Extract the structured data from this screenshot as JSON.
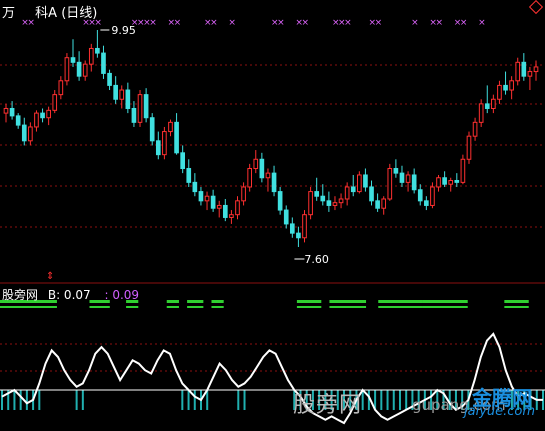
{
  "header": {
    "code_label": "万",
    "stock_label": "科A",
    "period_label": "(日线)"
  },
  "subpanel": {
    "name": "股旁网",
    "b_label": "B: 0.07",
    "value2_label": ": 0.09"
  },
  "watermark": {
    "text_cn": "股旁网",
    "url": "gupang.com",
    "logo_line1": "金腾网",
    "logo_line2": "jaiyue.com"
  },
  "colors": {
    "up": "#ff3030",
    "down": "#40e0e0",
    "grid": "#8b1010",
    "cross": "#e066ff",
    "indicator": "#ffffff",
    "bars": "#20b0b0",
    "signal": "#30d030"
  },
  "chart_data": {
    "type": "candlestick",
    "price_max_label": "9.95",
    "price_min_label": "7.60",
    "price_max": 9.95,
    "price_min": 7.6,
    "candles": [
      [
        9.05,
        9.15,
        8.95,
        9.1
      ],
      [
        9.1,
        9.18,
        8.98,
        9.02
      ],
      [
        9.02,
        9.05,
        8.88,
        8.92
      ],
      [
        8.92,
        9.0,
        8.7,
        8.75
      ],
      [
        8.75,
        8.95,
        8.7,
        8.9
      ],
      [
        8.9,
        9.08,
        8.85,
        9.05
      ],
      [
        9.05,
        9.1,
        8.95,
        9.0
      ],
      [
        9.0,
        9.12,
        8.92,
        9.08
      ],
      [
        9.08,
        9.3,
        9.05,
        9.25
      ],
      [
        9.25,
        9.45,
        9.2,
        9.4
      ],
      [
        9.4,
        9.7,
        9.35,
        9.65
      ],
      [
        9.65,
        9.85,
        9.55,
        9.6
      ],
      [
        9.6,
        9.72,
        9.4,
        9.45
      ],
      [
        9.45,
        9.62,
        9.4,
        9.58
      ],
      [
        9.58,
        9.8,
        9.5,
        9.75
      ],
      [
        9.75,
        9.95,
        9.65,
        9.7
      ],
      [
        9.7,
        9.78,
        9.42,
        9.48
      ],
      [
        9.48,
        9.52,
        9.3,
        9.35
      ],
      [
        9.35,
        9.45,
        9.15,
        9.2
      ],
      [
        9.2,
        9.35,
        9.1,
        9.3
      ],
      [
        9.3,
        9.38,
        9.05,
        9.1
      ],
      [
        9.1,
        9.18,
        8.9,
        8.95
      ],
      [
        8.95,
        9.3,
        8.9,
        9.25
      ],
      [
        9.25,
        9.32,
        8.95,
        9.0
      ],
      [
        9.0,
        9.05,
        8.7,
        8.75
      ],
      [
        8.75,
        8.85,
        8.55,
        8.6
      ],
      [
        8.6,
        8.9,
        8.55,
        8.85
      ],
      [
        8.85,
        8.98,
        8.8,
        8.95
      ],
      [
        8.95,
        9.05,
        8.6,
        8.62
      ],
      [
        8.62,
        8.7,
        8.4,
        8.45
      ],
      [
        8.45,
        8.55,
        8.25,
        8.3
      ],
      [
        8.3,
        8.4,
        8.15,
        8.2
      ],
      [
        8.2,
        8.25,
        8.05,
        8.1
      ],
      [
        8.1,
        8.2,
        8.0,
        8.15
      ],
      [
        8.15,
        8.22,
        7.98,
        8.02
      ],
      [
        8.02,
        8.1,
        7.92,
        8.05
      ],
      [
        8.05,
        8.12,
        7.88,
        7.92
      ],
      [
        7.92,
        8.0,
        7.85,
        7.95
      ],
      [
        7.95,
        8.15,
        7.9,
        8.1
      ],
      [
        8.1,
        8.3,
        8.05,
        8.25
      ],
      [
        8.25,
        8.5,
        8.2,
        8.45
      ],
      [
        8.45,
        8.65,
        8.4,
        8.55
      ],
      [
        8.55,
        8.62,
        8.3,
        8.35
      ],
      [
        8.35,
        8.45,
        8.2,
        8.4
      ],
      [
        8.4,
        8.48,
        8.15,
        8.2
      ],
      [
        8.2,
        8.25,
        7.95,
        8.0
      ],
      [
        8.0,
        8.05,
        7.8,
        7.85
      ],
      [
        7.85,
        7.92,
        7.7,
        7.75
      ],
      [
        7.75,
        7.82,
        7.6,
        7.7
      ],
      [
        7.7,
        8.0,
        7.65,
        7.95
      ],
      [
        7.95,
        8.25,
        7.9,
        8.2
      ],
      [
        8.2,
        8.35,
        8.1,
        8.15
      ],
      [
        8.15,
        8.28,
        8.05,
        8.1
      ],
      [
        8.1,
        8.2,
        7.98,
        8.05
      ],
      [
        8.05,
        8.15,
        8.0,
        8.08
      ],
      [
        8.08,
        8.18,
        8.02,
        8.12
      ],
      [
        8.12,
        8.3,
        8.05,
        8.25
      ],
      [
        8.25,
        8.38,
        8.15,
        8.2
      ],
      [
        8.2,
        8.42,
        8.18,
        8.38
      ],
      [
        8.38,
        8.45,
        8.2,
        8.25
      ],
      [
        8.25,
        8.32,
        8.05,
        8.1
      ],
      [
        8.1,
        8.18,
        7.98,
        8.02
      ],
      [
        8.02,
        8.15,
        7.95,
        8.12
      ],
      [
        8.12,
        8.5,
        8.1,
        8.45
      ],
      [
        8.45,
        8.55,
        8.35,
        8.4
      ],
      [
        8.4,
        8.48,
        8.25,
        8.3
      ],
      [
        8.3,
        8.42,
        8.2,
        8.38
      ],
      [
        8.38,
        8.45,
        8.18,
        8.22
      ],
      [
        8.22,
        8.28,
        8.05,
        8.1
      ],
      [
        8.1,
        8.15,
        8.0,
        8.05
      ],
      [
        8.05,
        8.3,
        8.02,
        8.25
      ],
      [
        8.25,
        8.38,
        8.2,
        8.35
      ],
      [
        8.35,
        8.42,
        8.25,
        8.28
      ],
      [
        8.28,
        8.35,
        8.2,
        8.32
      ],
      [
        8.32,
        8.4,
        8.25,
        8.3
      ],
      [
        8.3,
        8.6,
        8.28,
        8.55
      ],
      [
        8.55,
        8.85,
        8.5,
        8.8
      ],
      [
        8.8,
        9.0,
        8.75,
        8.95
      ],
      [
        8.95,
        9.2,
        8.9,
        9.15
      ],
      [
        9.15,
        9.35,
        9.05,
        9.1
      ],
      [
        9.1,
        9.25,
        9.05,
        9.2
      ],
      [
        9.2,
        9.4,
        9.15,
        9.35
      ],
      [
        9.35,
        9.5,
        9.25,
        9.3
      ],
      [
        9.3,
        9.45,
        9.2,
        9.4
      ],
      [
        9.4,
        9.65,
        9.35,
        9.6
      ],
      [
        9.6,
        9.7,
        9.4,
        9.45
      ],
      [
        9.45,
        9.55,
        9.3,
        9.5
      ],
      [
        9.5,
        9.62,
        9.4,
        9.55
      ]
    ],
    "cross_marker_indices": [
      3,
      4,
      13,
      14,
      15,
      21,
      22,
      23,
      24,
      27,
      28,
      33,
      34,
      37,
      44,
      45,
      48,
      49,
      54,
      55,
      56,
      60,
      61,
      67,
      70,
      71,
      74,
      75,
      78
    ],
    "indicator": {
      "zero_level": 0,
      "line": [
        -0.2,
        -0.1,
        0.0,
        -0.2,
        -0.4,
        -0.3,
        0.2,
        0.8,
        1.2,
        1.0,
        0.6,
        0.3,
        0.1,
        0.2,
        0.6,
        1.1,
        1.3,
        1.1,
        0.7,
        0.3,
        0.6,
        0.9,
        0.8,
        0.6,
        0.5,
        0.9,
        1.2,
        1.1,
        0.6,
        0.2,
        0.0,
        -0.2,
        -0.3,
        0.0,
        0.4,
        0.8,
        0.6,
        0.3,
        0.1,
        0.2,
        0.4,
        0.7,
        1.0,
        1.2,
        1.1,
        0.7,
        0.3,
        0.0,
        -0.2,
        -0.5,
        -0.7,
        -0.8,
        -0.9,
        -0.8,
        -0.9,
        -1.0,
        -0.7,
        -0.3,
        0.0,
        -0.2,
        -0.6,
        -0.8,
        -0.9,
        -0.8,
        -0.7,
        -0.6,
        -0.5,
        -0.4,
        -0.3,
        -0.2,
        0.0,
        -0.1,
        -0.4,
        -0.6,
        -0.5,
        -0.3,
        0.3,
        1.0,
        1.5,
        1.7,
        1.3,
        0.6,
        0.1,
        -0.2,
        -0.1,
        -0.2,
        -0.3,
        -0.3
      ],
      "signal_segments": [
        [
          0,
          14
        ],
        [
          22,
          27
        ],
        [
          31,
          34
        ],
        [
          41,
          44
        ],
        [
          46,
          50
        ],
        [
          52,
          55
        ],
        [
          73,
          79
        ],
        [
          81,
          90
        ],
        [
          93,
          104
        ],
        [
          104,
          115
        ],
        [
          124,
          130
        ]
      ]
    }
  }
}
